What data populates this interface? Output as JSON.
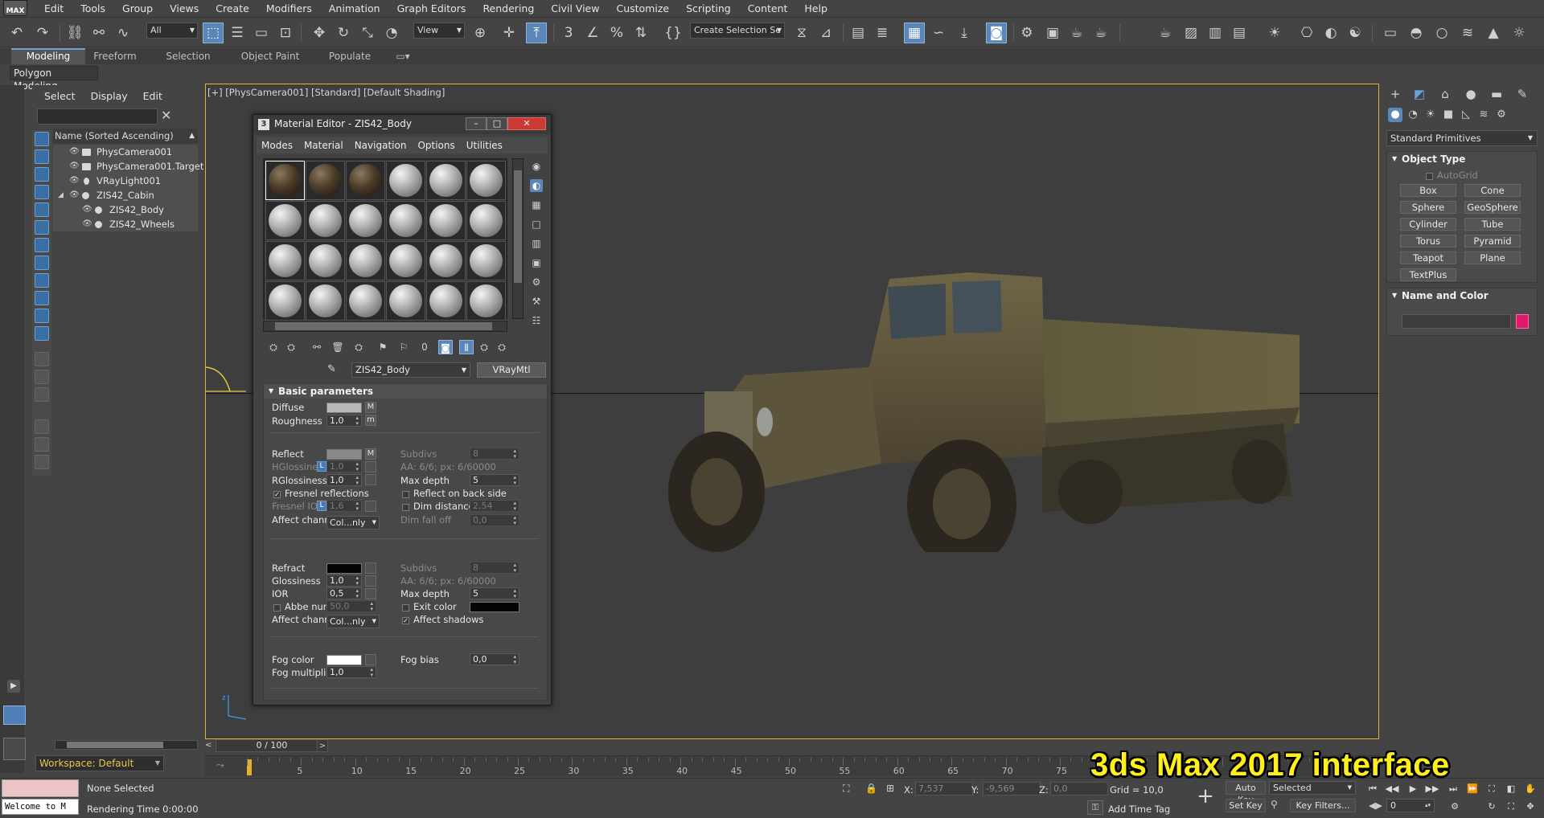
{
  "app": {
    "logo_text": "MAX",
    "menu": [
      "Edit",
      "Tools",
      "Group",
      "Views",
      "Create",
      "Modifiers",
      "Animation",
      "Graph Editors",
      "Rendering",
      "Civil View",
      "Customize",
      "Scripting",
      "Content",
      "Help"
    ]
  },
  "toolbar": {
    "filter_value": "All",
    "ref_coord_value": "View",
    "selection_set_value": "Create Selection Se"
  },
  "ribbon": {
    "tabs": [
      "Modeling",
      "Freeform",
      "Selection",
      "Object Paint",
      "Populate"
    ],
    "panel_label": "Polygon Modeling"
  },
  "scene_explorer": {
    "menu": [
      "Select",
      "Display",
      "Edit"
    ],
    "search_placeholder": "",
    "header": "Name (Sorted Ascending)",
    "rows": [
      {
        "label": "PhysCamera001"
      },
      {
        "label": "PhysCamera001.Target"
      },
      {
        "label": "VRayLight001"
      },
      {
        "label": "ZIS42_Cabin"
      },
      {
        "label": "ZIS42_Body"
      },
      {
        "label": "ZIS42_Wheels"
      }
    ],
    "workspace": "Workspace: Default"
  },
  "viewport": {
    "label": "[+] [PhysCamera001] [Standard] [Default Shading]",
    "accent_color": "#e2b33a"
  },
  "material_editor": {
    "title": "Material Editor - ZIS42_Body",
    "icon_text": "3",
    "window_buttons": {
      "minimize": "–",
      "restore": "□",
      "close": "✕"
    },
    "menu": [
      "Modes",
      "Material",
      "Navigation",
      "Options",
      "Utilities"
    ],
    "material_name": "ZIS42_Body",
    "material_type": "VRayMtl",
    "rollout_title": "Basic parameters",
    "params": {
      "diffuse": "Diffuse",
      "roughness": "Roughness",
      "roughness_value": "1,0",
      "reflect": "Reflect",
      "subdivs": "Subdivs",
      "subdivs_value": "8",
      "hglossiness": "HGlossiness",
      "hglossiness_value": "1,0",
      "aa_reflect": "AA: 6/6; px: 6/60000",
      "rglossiness": "RGlossiness",
      "rglossiness_value": "1,0",
      "max_depth": "Max depth",
      "max_depth_value": "5",
      "fresnel_reflections": "Fresnel reflections",
      "reflect_back_side": "Reflect on back side",
      "fresnel_ior": "Fresnel IOR",
      "fresnel_ior_value": "1,6",
      "dim_distance": "Dim distance",
      "dim_distance_value": "2,54",
      "affect_channels": "Affect channels",
      "affect_channels_value": "Col...nly",
      "dim_fall_off": "Dim fall off",
      "dim_fall_off_value": "0,0",
      "refract": "Refract",
      "refract_subdivs_value": "8",
      "aa_refract": "AA: 6/6; px: 6/60000",
      "glossiness": "Glossiness",
      "glossiness_value": "1,0",
      "ior": "IOR",
      "ior_value": "0,5",
      "refract_max_depth_value": "5",
      "abbe_number": "Abbe number",
      "abbe_number_value": "50,0",
      "exit_color": "Exit color",
      "refract_affect_value": "Col...nly",
      "affect_shadows": "Affect shadows",
      "fog_color": "Fog color",
      "fog_bias": "Fog bias",
      "fog_bias_value": "0,0",
      "fog_multiplier": "Fog multiplier",
      "fog_multiplier_value": "1,0",
      "m": "M",
      "m_lower": "m",
      "l": "L"
    }
  },
  "command_panel": {
    "category": "Standard Primitives",
    "object_type_title": "Object Type",
    "autogrid": "AutoGrid",
    "primitives": [
      "Box",
      "Cone",
      "Sphere",
      "GeoSphere",
      "Cylinder",
      "Tube",
      "Torus",
      "Pyramid",
      "Teapot",
      "Plane",
      "TextPlus"
    ],
    "name_color_title": "Name and Color",
    "object_color": "#e0196e"
  },
  "timeline": {
    "slider_label": "0 / 100",
    "tick_labels": [
      "5",
      "10",
      "15",
      "20",
      "25",
      "30",
      "35",
      "40",
      "45",
      "50",
      "55",
      "60",
      "65",
      "70",
      "75"
    ]
  },
  "status": {
    "maxscript_text": "Welcome to M",
    "selection": "None Selected",
    "render_time": "Rendering Time  0:00:00",
    "x_label": "X:",
    "x_value": "7,537",
    "y_label": "Y:",
    "y_value": "-9,569",
    "z_label": "Z:",
    "z_value": "0,0",
    "grid": "Grid = 10,0",
    "add_time_tag": "Add Time Tag",
    "auto_key": "Auto Key",
    "auto_key_mode": "Selected",
    "set_key": "Set Key",
    "key_filters": "Key Filters...",
    "frame_value": "0"
  },
  "banner": "3ds Max 2017 interface"
}
